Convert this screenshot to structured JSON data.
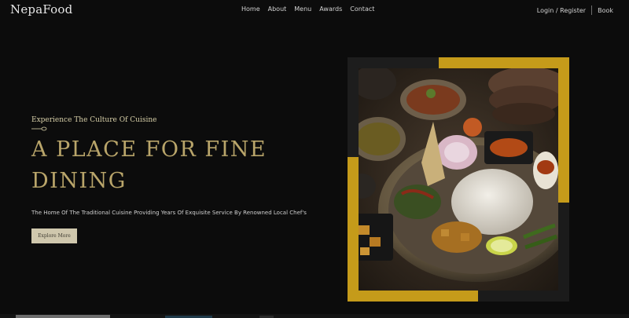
{
  "brand": {
    "name": "NepaFood"
  },
  "nav": {
    "links": [
      "Home",
      "About",
      "Menu",
      "Awards",
      "Contact"
    ],
    "login_label": "Login / Register",
    "book_label": "Book"
  },
  "hero": {
    "eyebrow": "Experience The Culture Of Cuisine",
    "divider_icon": "fork-icon",
    "headline_line1": "A PLACE FOR FINE",
    "headline_line2": "DINING",
    "subtext": "The Home Of The Traditional Cuisine Providing Years Of Exquisite Service By Renowned Local Chef's",
    "cta_label": "Explore More"
  },
  "image": {
    "subject": "thali plate with rice, curries and side dishes"
  },
  "colors": {
    "background": "#0c0c0c",
    "accent_gold": "#c59b1a",
    "headline": "#b9a56a",
    "button_bg": "#cfc7ad"
  }
}
